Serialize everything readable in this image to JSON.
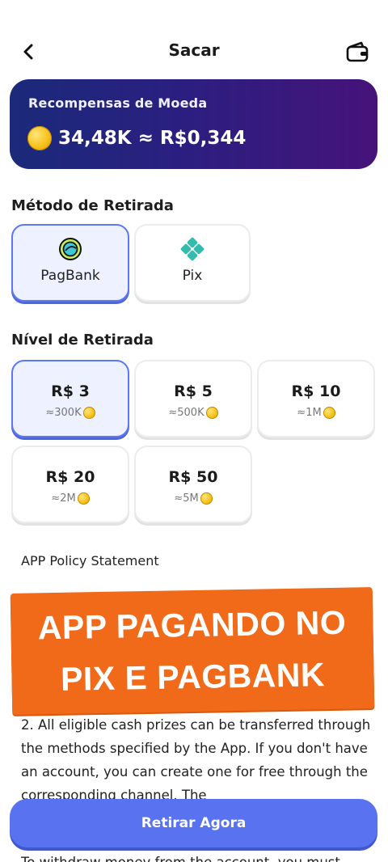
{
  "header": {
    "title": "Sacar",
    "back_icon": "chevron-left-icon",
    "wallet_icon": "wallet-icon"
  },
  "rewards": {
    "label": "Recompensas de Moeda",
    "value": "34,48K ≈ R$0,344",
    "icon": "coin-icon"
  },
  "methods": {
    "title": "Método de Retirada",
    "items": [
      {
        "label": "PagBank",
        "icon": "pagbank-icon",
        "selected": true
      },
      {
        "label": "Pix",
        "icon": "pix-icon",
        "selected": false
      }
    ]
  },
  "levels": {
    "title": "Nível de Retirada",
    "items": [
      {
        "amount": "R$ 3",
        "coins": "≈300K",
        "selected": true
      },
      {
        "amount": "R$ 5",
        "coins": "≈500K",
        "selected": false
      },
      {
        "amount": "R$ 10",
        "coins": "≈1M",
        "selected": false
      },
      {
        "amount": "R$ 20",
        "coins": "≈2M",
        "selected": false
      },
      {
        "amount": "R$ 50",
        "coins": "≈5M",
        "selected": false
      }
    ]
  },
  "policy": {
    "title": "APP Policy Statement",
    "banner_line1": "APP PAGANDO NO",
    "banner_line2": "PIX E PAGBANK",
    "text_1": "2. All eligible cash prizes can be transferred through the methods specified by the App. If you don't have an account, you can create one for free through the corresponding channel. The",
    "text_2": "To withdraw money from the account, you must"
  },
  "action": {
    "withdraw_label": "Retirar Agora"
  },
  "colors": {
    "accent": "#5872f0",
    "banner": "#f06a1a",
    "card_start": "#1b2a7a",
    "card_end": "#45137a",
    "coin": "#f6c21a"
  }
}
